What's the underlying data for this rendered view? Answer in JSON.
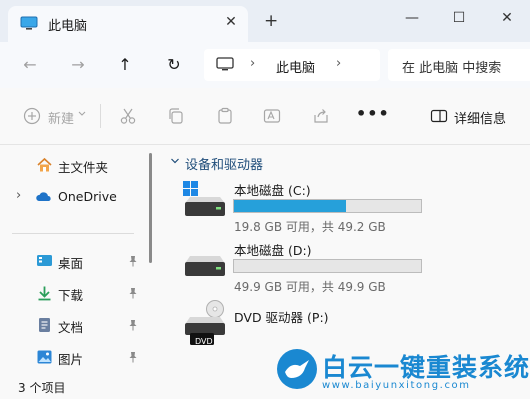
{
  "tab": {
    "title": "此电脑",
    "close": "✕",
    "new_tab": "+"
  },
  "window_controls": {
    "minimize": "—",
    "maximize": "☐",
    "close": "✕"
  },
  "nav": {
    "back": "←",
    "forward": "→",
    "up": "↑",
    "refresh": "↻",
    "address": {
      "separator": "›",
      "location": "此电脑",
      "trailing_separator": "›"
    },
    "search_placeholder": "在 此电脑 中搜索"
  },
  "commands": {
    "new_label": "新建",
    "more": "•••",
    "details_label": "详细信息"
  },
  "sidebar": {
    "items": [
      {
        "label": "主文件夹",
        "icon": "home-icon"
      },
      {
        "label": "OneDrive",
        "icon": "cloud-icon",
        "expand": "›"
      },
      {
        "label": "桌面",
        "icon": "desktop-icon",
        "pinned": true
      },
      {
        "label": "下载",
        "icon": "download-icon",
        "pinned": true
      },
      {
        "label": "文档",
        "icon": "document-icon",
        "pinned": true
      },
      {
        "label": "图片",
        "icon": "pictures-icon",
        "pinned": true
      }
    ]
  },
  "main": {
    "group_title": "设备和驱动器",
    "drives": [
      {
        "name": "本地磁盘 (C:)",
        "free_text": "19.8 GB 可用，共 49.2 GB",
        "used_fraction": 0.6,
        "bar_color": "#26a0da"
      },
      {
        "name": "本地磁盘 (D:)",
        "free_text": "49.9 GB 可用，共 49.9 GB",
        "used_fraction": 0.0,
        "bar_color": "#26a0da"
      },
      {
        "name": "DVD 驱动器 (P:)",
        "badge": "DVD"
      }
    ]
  },
  "status": {
    "item_count": "3 个项目"
  },
  "watermark": {
    "title": "白云一键重装系统",
    "url": "www.baiyunxitong.com"
  },
  "colors": {
    "accent": "#26a0da",
    "watermark": "#1a88d1",
    "tab_strip": "#e9eef5"
  }
}
